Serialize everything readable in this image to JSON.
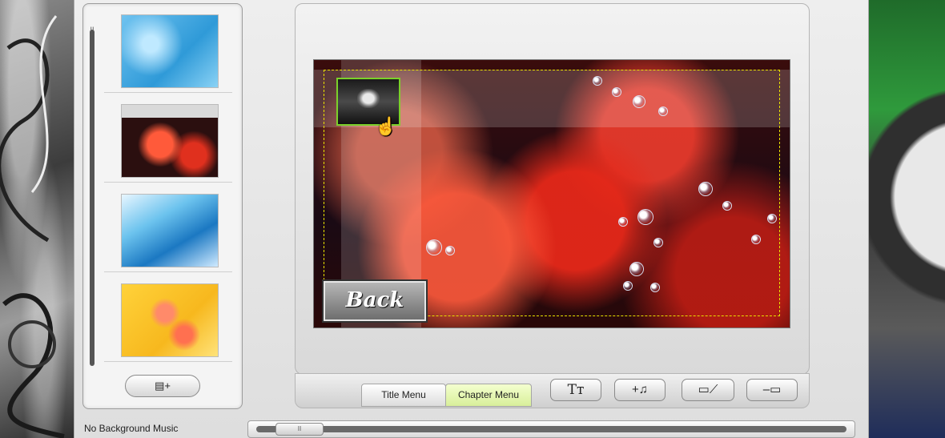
{
  "left_panel": {
    "scroll_grip": "II",
    "add_menu_icon": "▤+",
    "templates": [
      {
        "name": "blue-texture"
      },
      {
        "name": "red-petals"
      },
      {
        "name": "blue-waves"
      },
      {
        "name": "yellow-roses"
      }
    ]
  },
  "status": {
    "background_music": "No Background Music"
  },
  "preview": {
    "back_button_label": "Back"
  },
  "toolbar": {
    "tab_title_menu": "Title Menu",
    "tab_chapter_menu": "Chapter Menu",
    "text_button_label": "Tт",
    "music_button_label": "+♫",
    "edit_button_label": "▭⟋",
    "remove_button_label": "–▭"
  },
  "timeline": {
    "handle_grip": "II"
  },
  "colors": {
    "active_tab": "#d8ef9a",
    "safe_area": "#e8e000",
    "selection": "#7bd12a"
  }
}
